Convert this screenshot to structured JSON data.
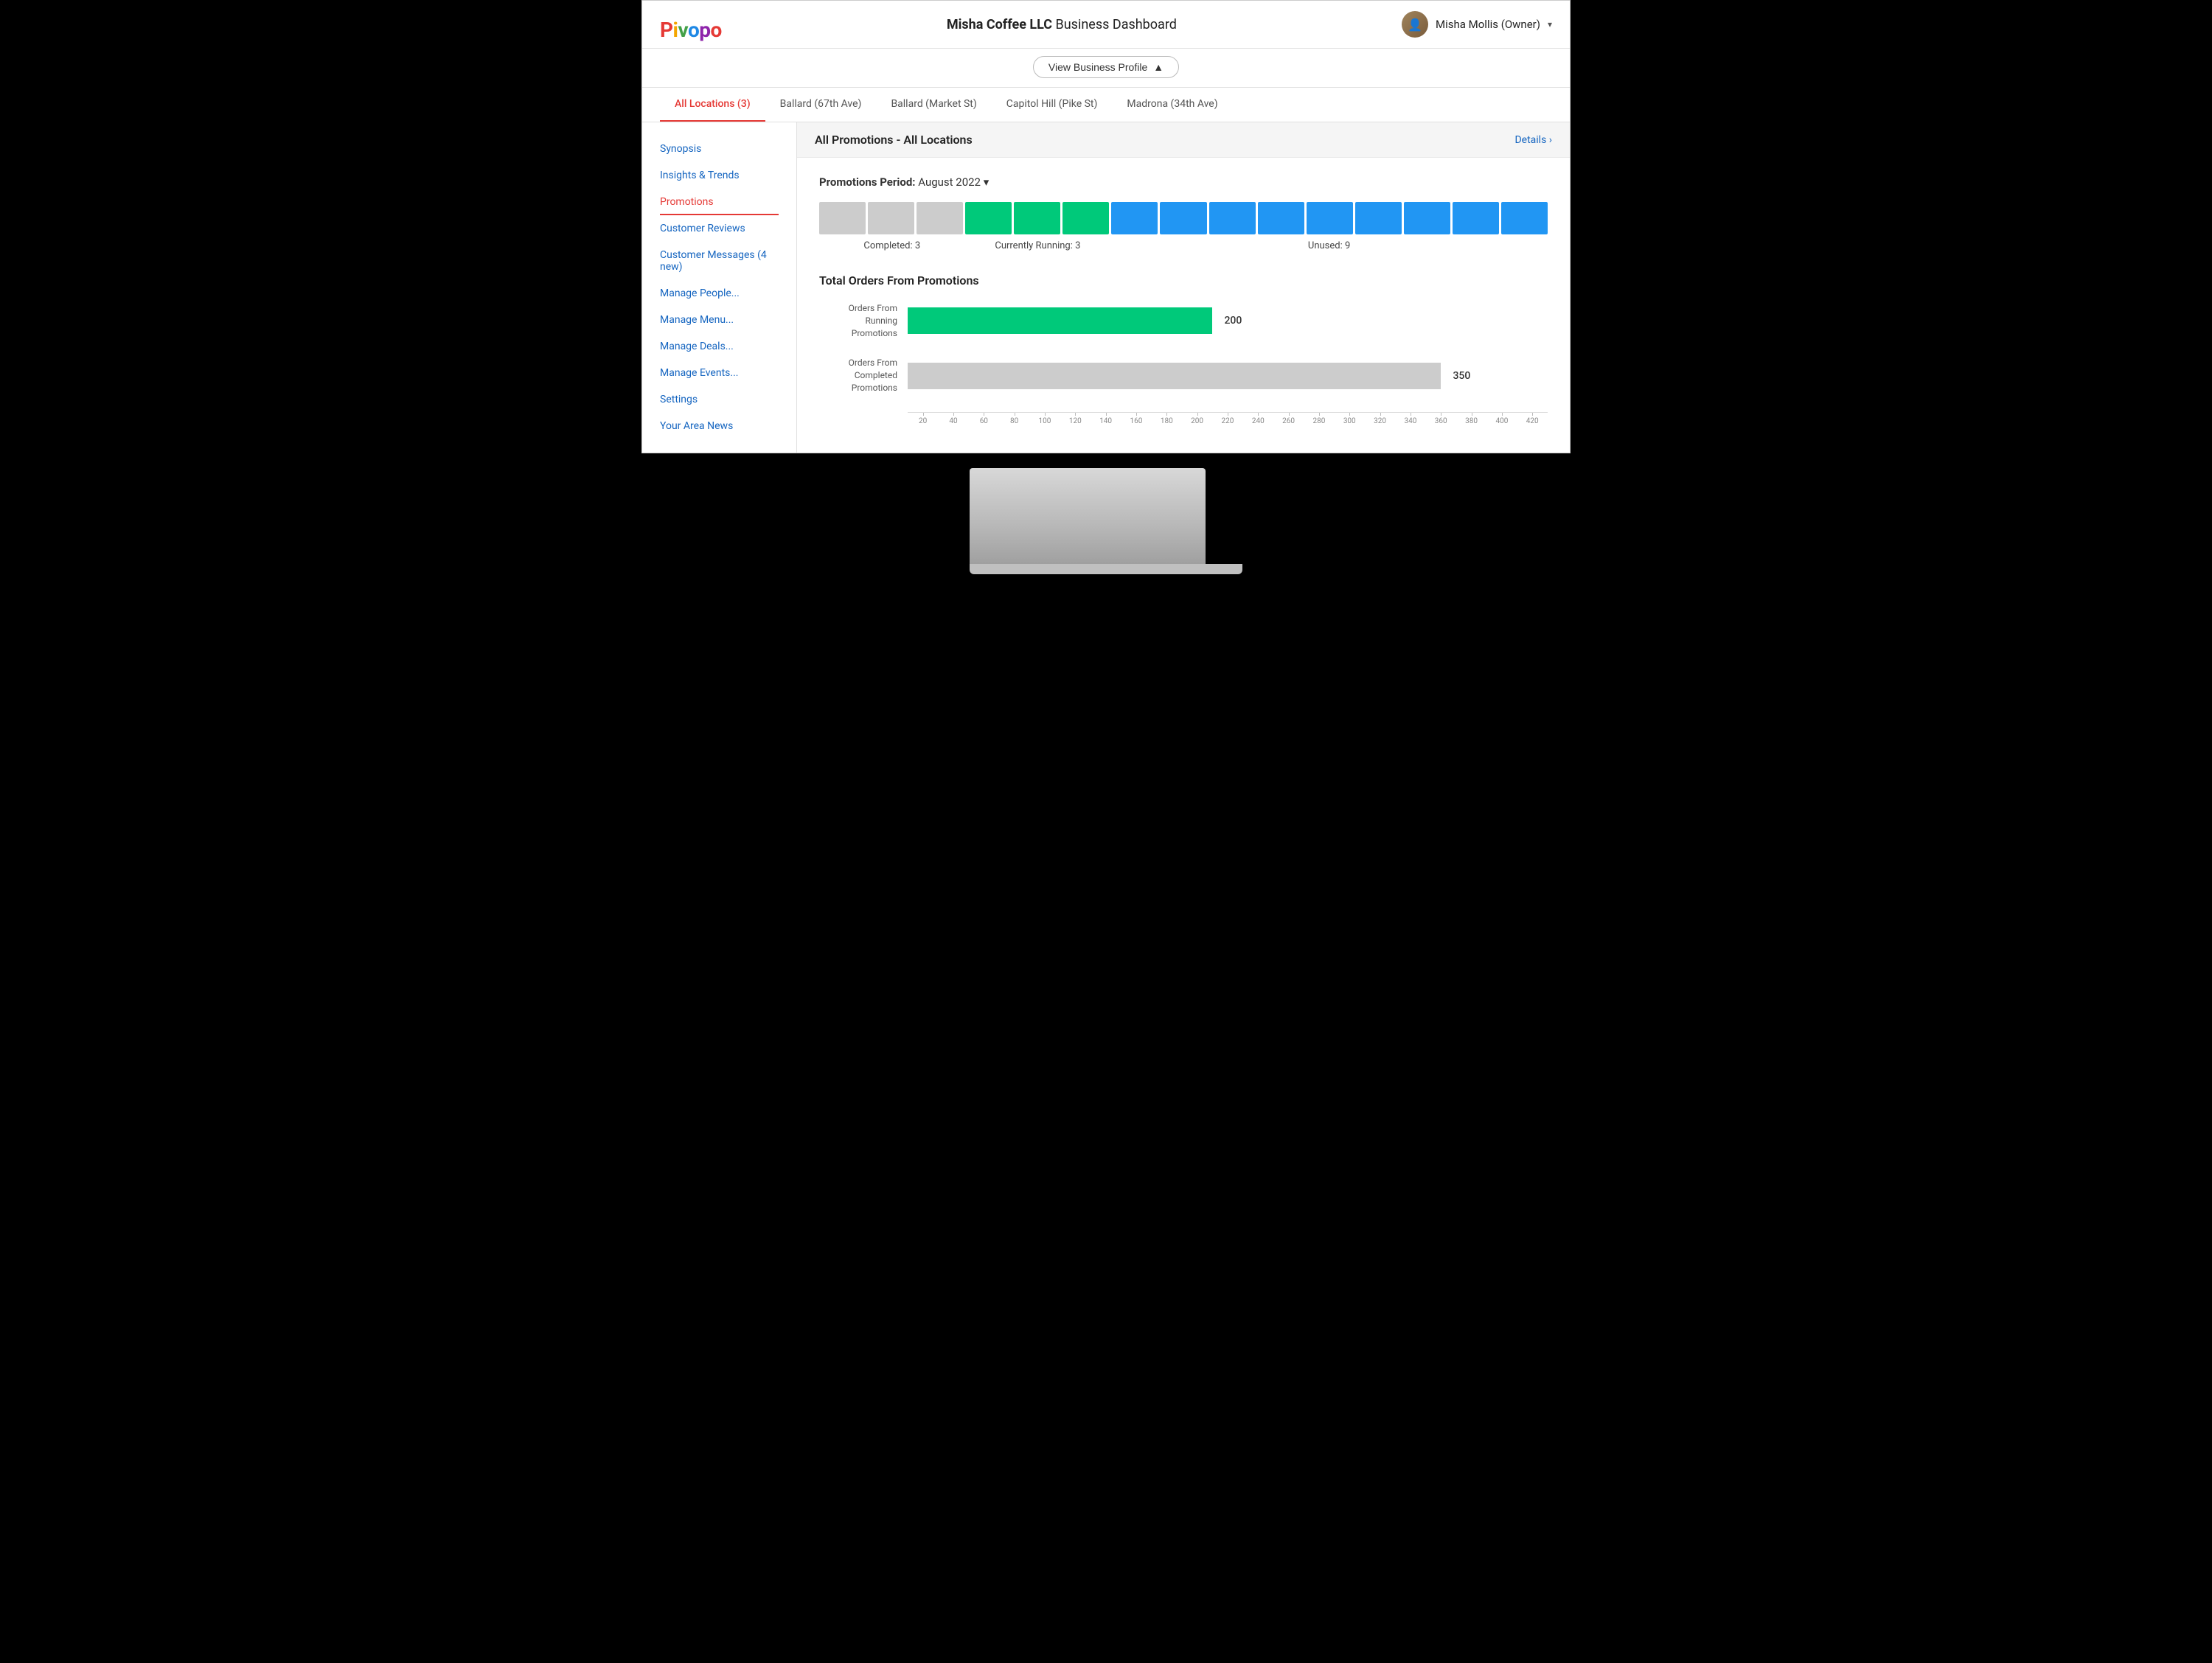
{
  "header": {
    "logo": "Pivopo",
    "title_prefix": "Misha Coffee LLC",
    "title_suffix": " Business Dashboard",
    "view_profile_btn": "View Business Profile",
    "user_name": "Misha Mollis (Owner)"
  },
  "location_tabs": {
    "tabs": [
      {
        "id": "all",
        "label": "All Locations (3)",
        "active": true
      },
      {
        "id": "ballard67",
        "label": "Ballard (67th Ave)",
        "active": false
      },
      {
        "id": "ballardmkt",
        "label": "Ballard (Market St)",
        "active": false
      },
      {
        "id": "capitolhill",
        "label": "Capitol Hill (Pike St)",
        "active": false
      },
      {
        "id": "madrona",
        "label": "Madrona (34th Ave)",
        "active": false
      }
    ]
  },
  "sidebar": {
    "items": [
      {
        "id": "synopsis",
        "label": "Synopsis",
        "active": false
      },
      {
        "id": "insights",
        "label": "Insights & Trends",
        "active": false
      },
      {
        "id": "promotions",
        "label": "Promotions",
        "active": true
      },
      {
        "id": "reviews",
        "label": "Customer Reviews",
        "active": false
      },
      {
        "id": "messages",
        "label": "Customer Messages (4 new)",
        "active": false
      },
      {
        "id": "people",
        "label": "Manage People...",
        "active": false
      },
      {
        "id": "menu",
        "label": "Manage Menu...",
        "active": false
      },
      {
        "id": "deals",
        "label": "Manage Deals...",
        "active": false
      },
      {
        "id": "events",
        "label": "Manage Events...",
        "active": false
      },
      {
        "id": "settings",
        "label": "Settings",
        "active": false
      },
      {
        "id": "news",
        "label": "Your Area News",
        "active": false
      }
    ]
  },
  "section": {
    "title": "All Promotions - All Locations",
    "details_link": "Details ›"
  },
  "promotions_period": {
    "label": "Promotions Period:",
    "value": "August 2022",
    "completed_count": 3,
    "running_count": 3,
    "unused_count": 9,
    "completed_label": "Completed: 3",
    "running_label": "Currently Running: 3",
    "unused_label": "Unused: 9"
  },
  "chart": {
    "title": "Total Orders From Promotions",
    "bars": [
      {
        "label": "Orders From\nRunning Promotions",
        "value": 200,
        "color": "green"
      },
      {
        "label": "Orders From\nCompleted Promotions",
        "value": 350,
        "color": "gray"
      }
    ],
    "max_value": 420,
    "axis_ticks": [
      "20",
      "40",
      "60",
      "80",
      "100",
      "120",
      "140",
      "160",
      "180",
      "200",
      "220",
      "240",
      "260",
      "280",
      "300",
      "320",
      "340",
      "360",
      "380",
      "400",
      "420"
    ]
  }
}
